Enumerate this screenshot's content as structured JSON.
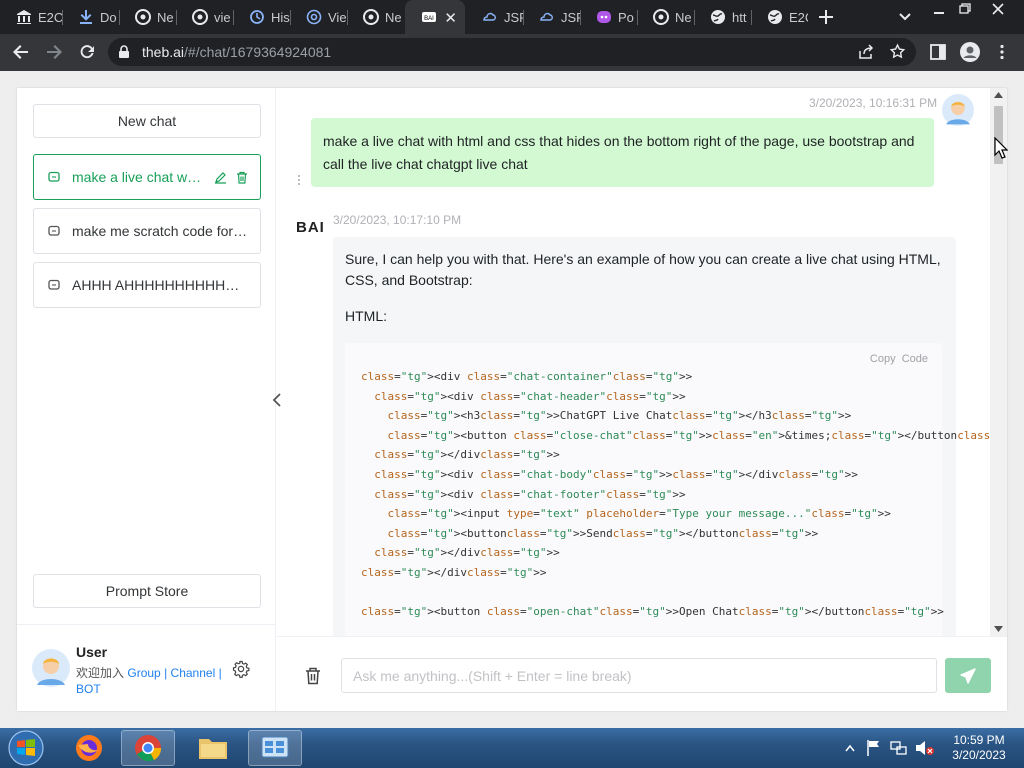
{
  "browser": {
    "tabs": [
      {
        "label": "E2C",
        "icon": "bank-icon"
      },
      {
        "label": "Do",
        "icon": "download-icon"
      },
      {
        "label": "Ne",
        "icon": "chrome-icon"
      },
      {
        "label": "vie",
        "icon": "chrome-icon"
      },
      {
        "label": "His",
        "icon": "history-icon"
      },
      {
        "label": "Vie",
        "icon": "at-icon"
      },
      {
        "label": "Ne",
        "icon": "chrome-icon"
      },
      {
        "label": "",
        "icon": "theb-icon",
        "active": true
      },
      {
        "label": "JSF",
        "icon": "jsfiddle-icon"
      },
      {
        "label": "JSF",
        "icon": "jsfiddle-icon"
      },
      {
        "label": "Po",
        "icon": "poe-icon"
      },
      {
        "label": "Ne",
        "icon": "chrome-icon"
      },
      {
        "label": "htt",
        "icon": "globe-icon"
      },
      {
        "label": "E2C",
        "icon": "globe-icon"
      }
    ],
    "url_host": "theb.ai",
    "url_path": "/#/chat/1679364924081"
  },
  "sidebar": {
    "new_chat_label": "New chat",
    "chats": [
      {
        "label": "make a live chat with html and css that hides on the bottom right of the page",
        "active": true
      },
      {
        "label": "make me scratch code for a game"
      },
      {
        "label": "AHHH AHHHHHHHHHHHHHHH"
      }
    ],
    "prompt_store_label": "Prompt Store",
    "user": {
      "name": "User",
      "join_text": "欢迎加入",
      "group_link": "Group",
      "sep1": "|",
      "channel_link": "Channel",
      "sep2": "|",
      "bot_link": "BOT"
    }
  },
  "conversation": {
    "user_message": {
      "time": "3/20/2023, 10:16:31 PM",
      "text": "make a live chat with html and css that hides on the bottom right of the page, use bootstrap and call the live chat chatgpt live chat"
    },
    "bot_message": {
      "brand": "BAI",
      "time": "3/20/2023, 10:17:10 PM",
      "intro": "Sure, I can help you with that. Here's an example of how you can create a live chat using HTML, CSS, and Bootstrap:",
      "section_label": "HTML:",
      "copy_label": "Copy",
      "code_label": "Code",
      "code_lines": [
        "<div class=\"chat-container\">",
        "  <div class=\"chat-header\">",
        "    <h3>ChatGPT Live Chat</h3>",
        "    <button class=\"close-chat\">&times;</button>",
        "  </div>",
        "  <div class=\"chat-body\"></div>",
        "  <div class=\"chat-footer\">",
        "    <input type=\"text\" placeholder=\"Type your message...\">",
        "    <button>Send</button>",
        "  </div>",
        "</div>",
        "",
        "<button class=\"open-chat\">Open Chat</button>"
      ]
    }
  },
  "input": {
    "placeholder": "Ask me anything...(Shift + Enter = line break)"
  },
  "taskbar": {
    "time": "10:59 PM",
    "date": "3/20/2023"
  },
  "colors": {
    "accent": "#18a058",
    "user_bubble": "#d2f9d1",
    "send_button": "#8fd4ad"
  }
}
